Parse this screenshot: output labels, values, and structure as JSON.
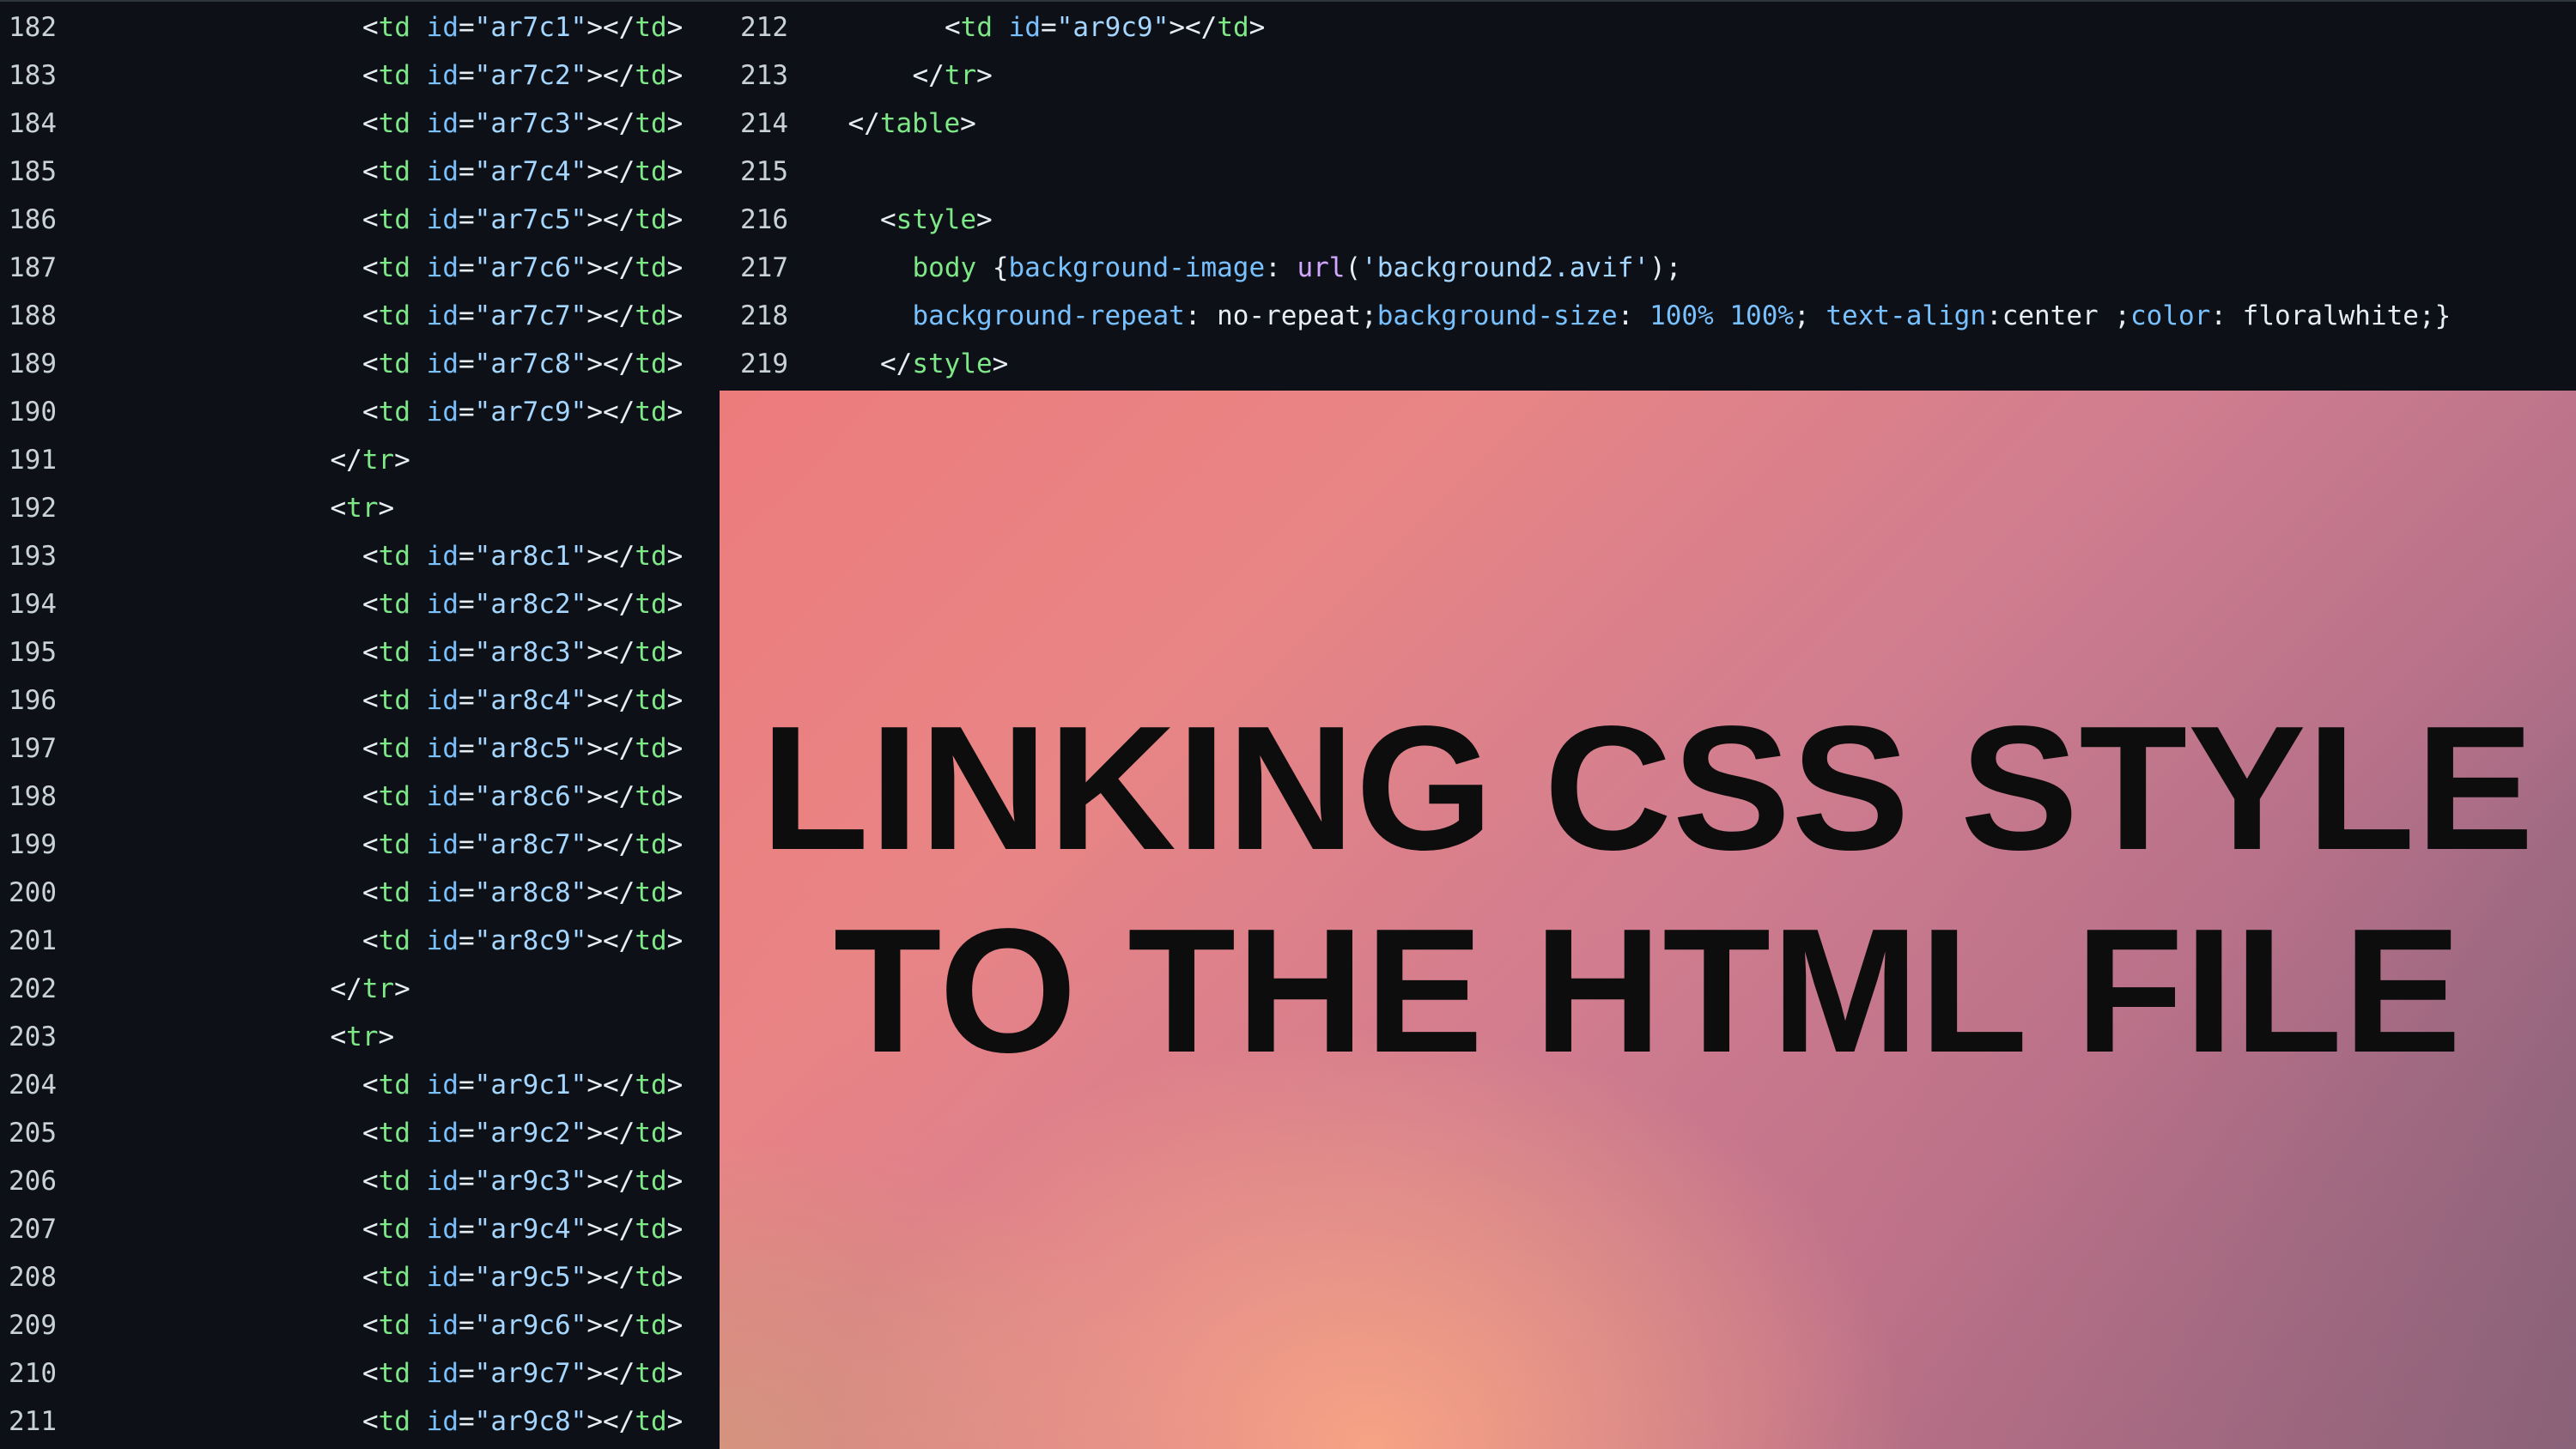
{
  "left_editor": {
    "lines": [
      {
        "n": "182",
        "indent": 8,
        "id": "ar7c1"
      },
      {
        "n": "183",
        "indent": 8,
        "id": "ar7c2"
      },
      {
        "n": "184",
        "indent": 8,
        "id": "ar7c3"
      },
      {
        "n": "185",
        "indent": 8,
        "id": "ar7c4"
      },
      {
        "n": "186",
        "indent": 8,
        "id": "ar7c5"
      },
      {
        "n": "187",
        "indent": 8,
        "id": "ar7c6"
      },
      {
        "n": "188",
        "indent": 8,
        "id": "ar7c7"
      },
      {
        "n": "189",
        "indent": 8,
        "id": "ar7c8"
      },
      {
        "n": "190",
        "indent": 8,
        "id": "ar7c9"
      },
      {
        "n": "191",
        "indent": 7,
        "close": "tr"
      },
      {
        "n": "192",
        "indent": 7,
        "open": "tr"
      },
      {
        "n": "193",
        "indent": 8,
        "id": "ar8c1"
      },
      {
        "n": "194",
        "indent": 8,
        "id": "ar8c2"
      },
      {
        "n": "195",
        "indent": 8,
        "id": "ar8c3"
      },
      {
        "n": "196",
        "indent": 8,
        "id": "ar8c4"
      },
      {
        "n": "197",
        "indent": 8,
        "id": "ar8c5"
      },
      {
        "n": "198",
        "indent": 8,
        "id": "ar8c6"
      },
      {
        "n": "199",
        "indent": 8,
        "id": "ar8c7"
      },
      {
        "n": "200",
        "indent": 8,
        "id": "ar8c8"
      },
      {
        "n": "201",
        "indent": 8,
        "id": "ar8c9"
      },
      {
        "n": "202",
        "indent": 7,
        "close": "tr"
      },
      {
        "n": "203",
        "indent": 7,
        "open": "tr"
      },
      {
        "n": "204",
        "indent": 8,
        "id": "ar9c1"
      },
      {
        "n": "205",
        "indent": 8,
        "id": "ar9c2"
      },
      {
        "n": "206",
        "indent": 8,
        "id": "ar9c3"
      },
      {
        "n": "207",
        "indent": 8,
        "id": "ar9c4"
      },
      {
        "n": "208",
        "indent": 8,
        "id": "ar9c5"
      },
      {
        "n": "209",
        "indent": 8,
        "id": "ar9c6"
      },
      {
        "n": "210",
        "indent": 8,
        "id": "ar9c7"
      },
      {
        "n": "211",
        "indent": 8,
        "id": "ar9c8"
      }
    ]
  },
  "right_editor": {
    "lines": [
      {
        "n": "212",
        "indent": 8,
        "id": "ar9c9"
      },
      {
        "n": "213",
        "indent": 7,
        "close": "tr"
      },
      {
        "n": "214",
        "indent": 5,
        "close": "table"
      },
      {
        "n": "215",
        "indent": 0,
        "blank": true
      },
      {
        "n": "216",
        "indent": 6,
        "open": "style"
      },
      {
        "n": "217",
        "indent": 7,
        "css": [
          {
            "t": "body",
            "c": "sel"
          },
          {
            "t": " {",
            "c": "p"
          },
          {
            "t": "background-image",
            "c": "prop"
          },
          {
            "t": ": ",
            "c": "p"
          },
          {
            "t": "url",
            "c": "fn"
          },
          {
            "t": "(",
            "c": "p"
          },
          {
            "t": "'background2.avif'",
            "c": "str"
          },
          {
            "t": ");",
            "c": "p"
          }
        ]
      },
      {
        "n": "218",
        "indent": 7,
        "css": [
          {
            "t": "background-repeat",
            "c": "prop"
          },
          {
            "t": ": ",
            "c": "p"
          },
          {
            "t": "no-repeat",
            "c": "val"
          },
          {
            "t": ";",
            "c": "p"
          },
          {
            "t": "background-size",
            "c": "prop"
          },
          {
            "t": ": ",
            "c": "p"
          },
          {
            "t": "100%",
            "c": "num"
          },
          {
            "t": " ",
            "c": "p"
          },
          {
            "t": "100%",
            "c": "num"
          },
          {
            "t": "; ",
            "c": "p"
          },
          {
            "t": "text-align",
            "c": "prop"
          },
          {
            "t": ":",
            "c": "p"
          },
          {
            "t": "center",
            "c": "val"
          },
          {
            "t": " ;",
            "c": "p"
          },
          {
            "t": "color",
            "c": "prop"
          },
          {
            "t": ": ",
            "c": "p"
          },
          {
            "t": "floralwhite",
            "c": "val"
          },
          {
            "t": ";}",
            "c": "p"
          }
        ]
      },
      {
        "n": "219",
        "indent": 6,
        "close": "style"
      }
    ]
  },
  "banner": {
    "title_line1": "LINKING CSS STYLE",
    "title_line2": "TO THE HTML FILE"
  },
  "colors": {
    "editor_bg": "#0d1117",
    "tag": "#7ee787",
    "attr": "#79c0ff",
    "string": "#a5d6ff",
    "banner_text": "#0d0d0d"
  }
}
